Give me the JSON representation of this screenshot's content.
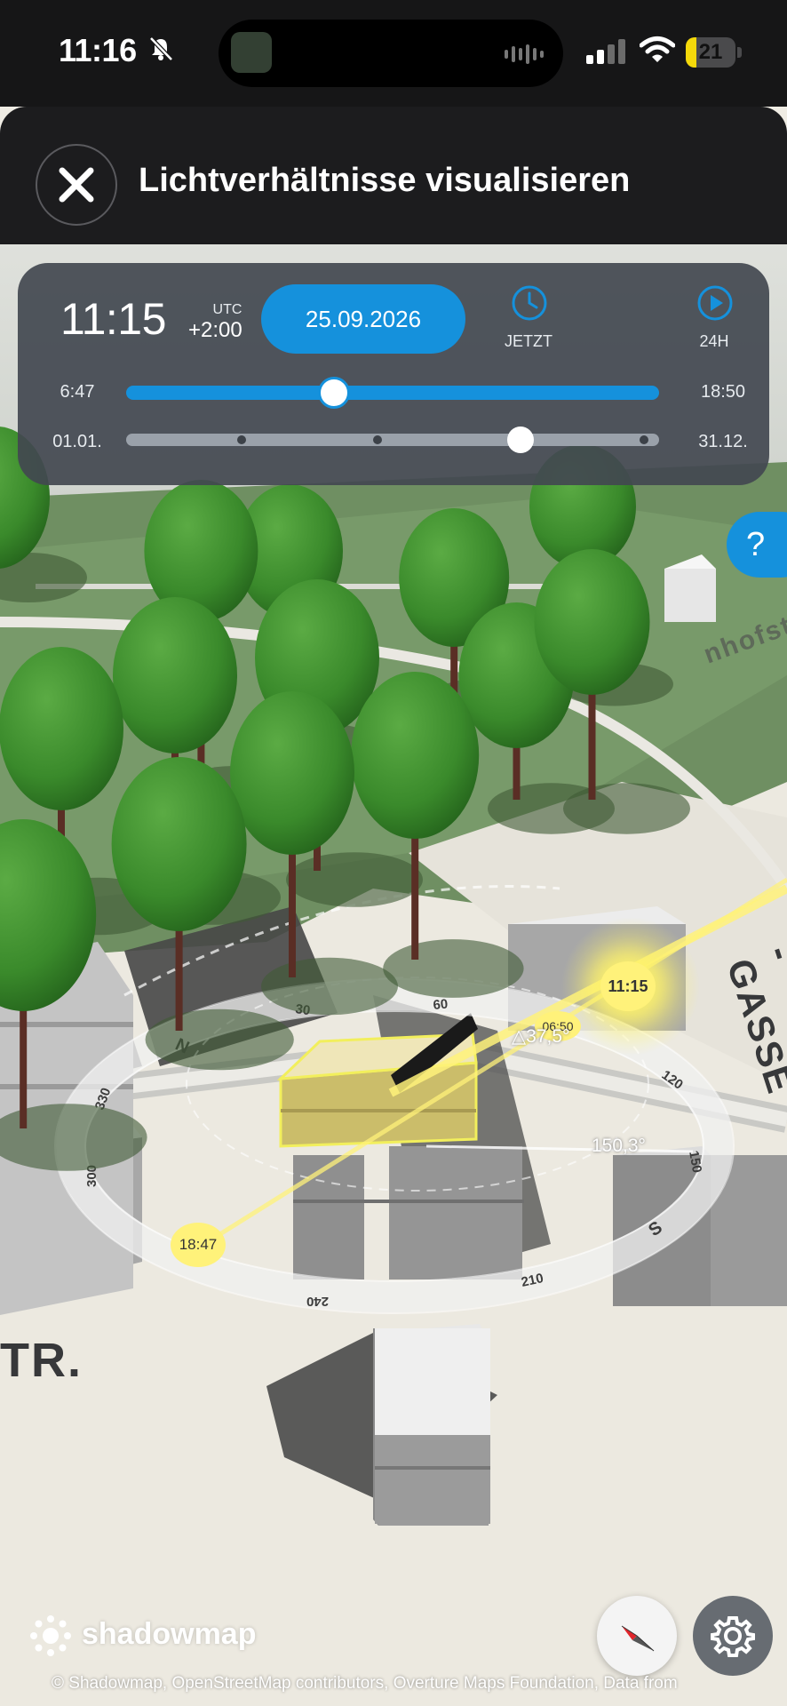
{
  "status_bar": {
    "time": "11:16",
    "battery_level": "21",
    "battery_fraction": 0.21,
    "icons": [
      "bell-slash-icon",
      "now-playing-waveform-icon",
      "signal-icon",
      "wifi-icon",
      "battery-icon"
    ]
  },
  "header": {
    "title": "Lichtverhältnisse visualisieren",
    "close_icon": "close-icon"
  },
  "time_panel": {
    "time": "11:15",
    "utc_label": "UTC",
    "utc_offset": "+2:00",
    "date": "25.09.2026",
    "now_label": "JETZT",
    "now_icon": "clock-icon",
    "play_label": "24H",
    "play_icon": "play-icon",
    "sunrise": "6:47",
    "sunset": "18:50",
    "time_slider_fraction": 0.39,
    "date_start": "01.01.",
    "date_end": "31.12.",
    "date_slider_fraction": 0.74,
    "colors": {
      "accent": "#1591dc",
      "panel": "#424850"
    }
  },
  "help": {
    "label": "?"
  },
  "map": {
    "streets": [
      "TR.",
      "-GASSE",
      "nhofstr."
    ],
    "sun_markers": {
      "current": "11:15",
      "sunrise": "06:50",
      "sunset": "18:47"
    },
    "elevation": "37,5°",
    "azimuth": "150,3°",
    "compass_labels": [
      "N",
      "30",
      "60",
      "120",
      "150",
      "S",
      "210",
      "240",
      "300",
      "330"
    ],
    "colors": {
      "sun": "#fff27a",
      "grass": "#6f8f62",
      "tree": "#3d8a2e"
    }
  },
  "controls": {
    "compass_icon": "compass-icon",
    "settings_icon": "gear-icon"
  },
  "footer": {
    "logo": "shadowmap",
    "attribution": "© Shadowmap, OpenStreetMap contributors, Overture Maps Foundation, Data from"
  }
}
